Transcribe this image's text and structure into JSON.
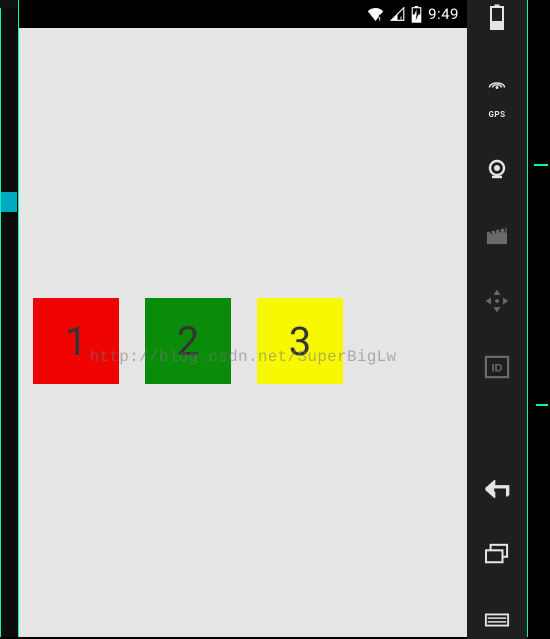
{
  "statusbar": {
    "clock": "9:49"
  },
  "app": {
    "boxes": [
      {
        "label": "1",
        "color": "red"
      },
      {
        "label": "2",
        "color": "green"
      },
      {
        "label": "3",
        "color": "yellow"
      }
    ]
  },
  "watermark": "http://blog.csdn.net/SuperBigLw",
  "sidebar": {
    "gps_label": "GPS"
  }
}
